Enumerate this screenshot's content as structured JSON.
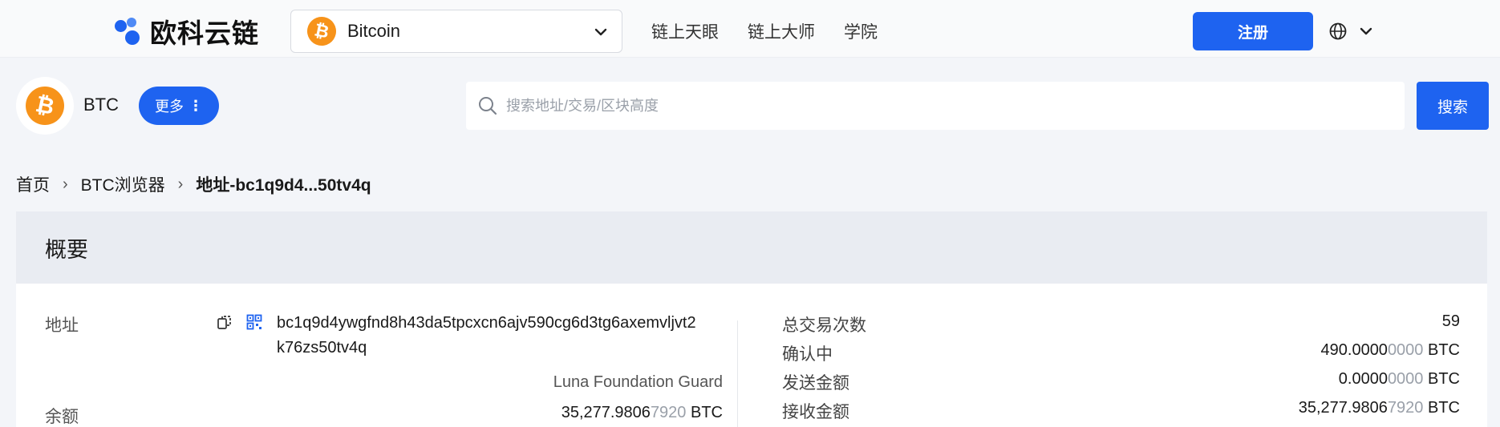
{
  "header": {
    "brand": "欧科云链",
    "chain_select": {
      "coin_glyph": "₿",
      "label": "Bitcoin"
    },
    "nav": [
      "链上天眼",
      "链上大师",
      "学院"
    ],
    "register_label": "注册"
  },
  "coinbar": {
    "coin_glyph": "₿",
    "symbol": "BTC",
    "more_label": "更多",
    "more_dots": "⋮",
    "search_placeholder": "搜索地址/交易/区块高度",
    "search_button": "搜索"
  },
  "breadcrumb": {
    "items": [
      "首页",
      "BTC浏览器"
    ],
    "current": "地址-bc1q9d4...50tv4q",
    "separator": "›"
  },
  "overview": {
    "title": "概要",
    "address_label": "地址",
    "address_line1": "bc1q9d4ywgfnd8h43da5tpcxcn6ajv590cg6d3tg6axemvljvt2",
    "address_line2": "k76zs50tv4q",
    "entity_tag": "Luna Foundation Guard",
    "balance_label": "余额",
    "balance_main": "35,277.9806",
    "balance_dim": "7920",
    "balance_unit": " BTC",
    "stats": [
      {
        "label": "总交易次数",
        "main": "59",
        "dim": "",
        "unit": ""
      },
      {
        "label": "确认中",
        "main": "490.0000",
        "dim": "0000",
        "unit": " BTC"
      },
      {
        "label": "发送金额",
        "main": "0.0000",
        "dim": "0000",
        "unit": " BTC"
      },
      {
        "label": "接收金额",
        "main": "35,277.9806",
        "dim": "7920",
        "unit": " BTC"
      }
    ]
  },
  "colors": {
    "accent": "#1e63f0",
    "bitcoin": "#f7931a"
  }
}
